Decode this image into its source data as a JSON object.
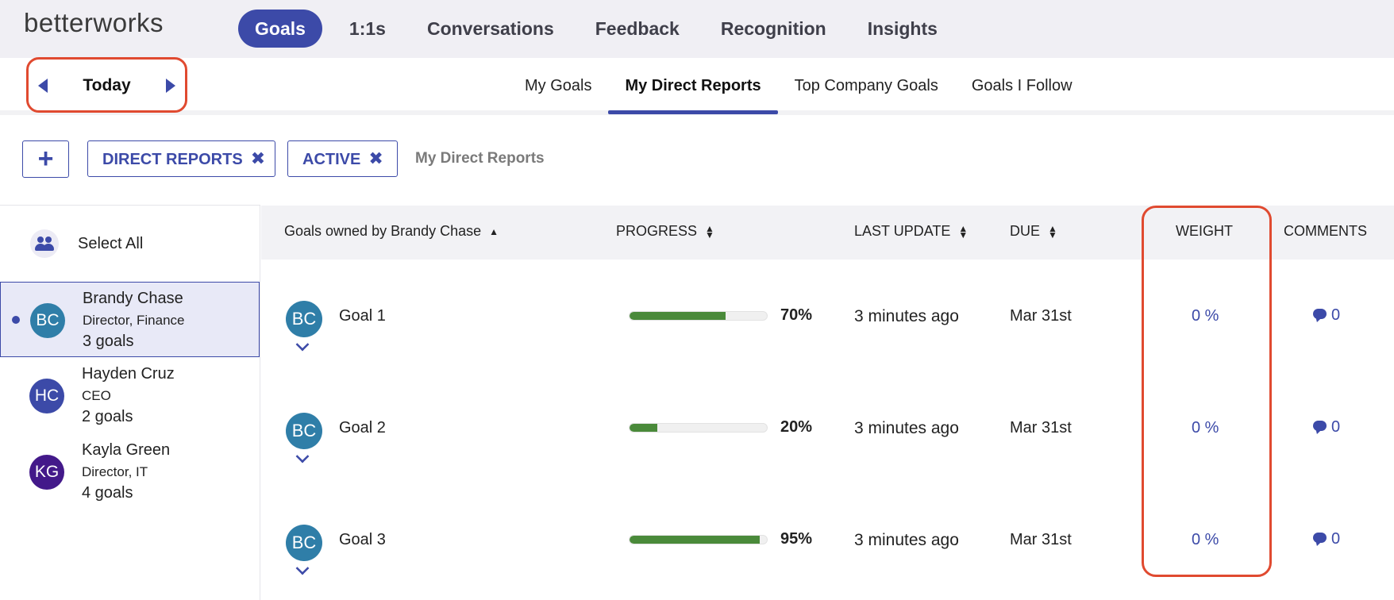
{
  "app": {
    "logo": "betterworks"
  },
  "topnav": {
    "items": [
      {
        "label": "Goals",
        "active": true
      },
      {
        "label": "1:1s"
      },
      {
        "label": "Conversations"
      },
      {
        "label": "Feedback"
      },
      {
        "label": "Recognition"
      },
      {
        "label": "Insights"
      }
    ]
  },
  "date_nav": {
    "label": "Today"
  },
  "subnav": {
    "items": [
      {
        "label": "My Goals"
      },
      {
        "label": "My Direct Reports",
        "active": true
      },
      {
        "label": "Top Company Goals"
      },
      {
        "label": "Goals I Follow"
      }
    ]
  },
  "filters": {
    "add_label": "+",
    "chips": [
      {
        "label": "DIRECT REPORTS",
        "remove": "✖"
      },
      {
        "label": "ACTIVE",
        "remove": "✖"
      }
    ],
    "context_label": "My Direct Reports"
  },
  "people": {
    "select_all": "Select All",
    "list": [
      {
        "initials": "BC",
        "name": "Brandy Chase",
        "title": "Director, Finance",
        "goals": "3 goals",
        "color": "#2f7ea8",
        "selected": true
      },
      {
        "initials": "HC",
        "name": "Hayden Cruz",
        "title": "CEO",
        "goals": "2 goals",
        "color": "#3c4aa8"
      },
      {
        "initials": "KG",
        "name": "Kayla Green",
        "title": "Director, IT",
        "goals": "4 goals",
        "color": "#43198a"
      }
    ]
  },
  "table": {
    "headers": {
      "goals": "Goals owned by Brandy Chase",
      "progress": "PROGRESS",
      "last_update": "LAST UPDATE",
      "due": "DUE",
      "weight": "WEIGHT",
      "comments": "COMMENTS"
    },
    "rows": [
      {
        "initials": "BC",
        "name": "Goal 1",
        "progress": 70,
        "progress_label": "70%",
        "updated": "3 minutes ago",
        "due": "Mar 31st",
        "weight": "0 %",
        "comments": "0"
      },
      {
        "initials": "BC",
        "name": "Goal 2",
        "progress": 20,
        "progress_label": "20%",
        "updated": "3 minutes ago",
        "due": "Mar 31st",
        "weight": "0 %",
        "comments": "0"
      },
      {
        "initials": "BC",
        "name": "Goal 3",
        "progress": 95,
        "progress_label": "95%",
        "updated": "3 minutes ago",
        "due": "Mar 31st",
        "weight": "0 %",
        "comments": "0"
      }
    ]
  },
  "colors": {
    "accent": "#3c4aa8",
    "highlight": "#e04a30",
    "progress": "#4a8a3a"
  }
}
